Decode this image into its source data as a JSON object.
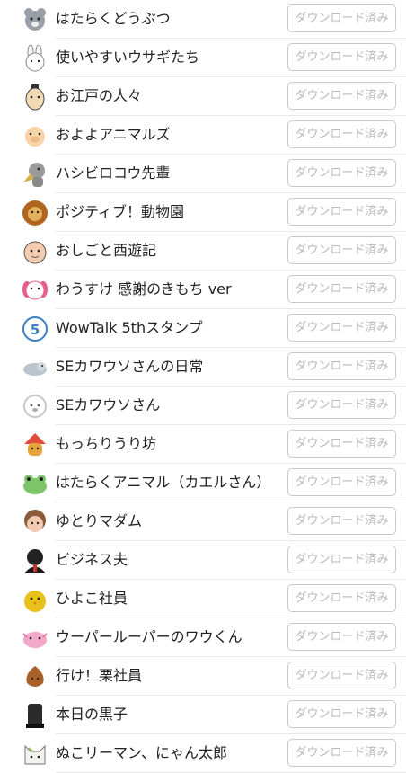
{
  "stickers": [
    {
      "name": "はたらくどうぶつ",
      "button": "ダウンロード済み",
      "icon": "bear-icon",
      "color": "#9aa0a8"
    },
    {
      "name": "使いやすいウサギたち",
      "button": "ダウンロード済み",
      "icon": "rabbit-icon",
      "color": "#f5f5f5"
    },
    {
      "name": "お江戸の人々",
      "button": "ダウンロード済み",
      "icon": "edo-person-icon",
      "color": "#f1d9b5"
    },
    {
      "name": "およよアニマルズ",
      "button": "ダウンロード済み",
      "icon": "pig-icon",
      "color": "#f7d3a8"
    },
    {
      "name": "ハシビロコウ先輩",
      "button": "ダウンロード済み",
      "icon": "shoebill-icon",
      "color": "#9a9a9a"
    },
    {
      "name": "ポジティブ！動物園",
      "button": "ダウンロード済み",
      "icon": "lion-icon",
      "color": "#b0651f"
    },
    {
      "name": "おしごと西遊記",
      "button": "ダウンロード済み",
      "icon": "monk-icon",
      "color": "#f3ccb0"
    },
    {
      "name": "わうすけ 感謝のきもち ver",
      "button": "ダウンロード済み",
      "icon": "dog-icon",
      "color": "#e85d8a"
    },
    {
      "name": "WowTalk 5thスタンプ",
      "button": "ダウンロード済み",
      "icon": "anniversary-5-icon",
      "color": "#3d7fc4"
    },
    {
      "name": "SEカワウソさんの日常",
      "button": "ダウンロード済み",
      "icon": "otter-icon",
      "color": "#b9c4cc"
    },
    {
      "name": "SEカワウソさん",
      "button": "ダウンロード済み",
      "icon": "otter-face-icon",
      "color": "#c9c9c9"
    },
    {
      "name": "もっちりうり坊",
      "button": "ダウンロード済み",
      "icon": "boar-icon",
      "color": "#e6a23c"
    },
    {
      "name": "はたらくアニマル（カエルさん）",
      "button": "ダウンロード済み",
      "icon": "frog-icon",
      "color": "#7cc46a"
    },
    {
      "name": "ゆとりマダム",
      "button": "ダウンロード済み",
      "icon": "madam-icon",
      "color": "#f0c9b0"
    },
    {
      "name": "ビジネス夫",
      "button": "ダウンロード済み",
      "icon": "business-man-icon",
      "color": "#222222"
    },
    {
      "name": "ひよこ社員",
      "button": "ダウンロード済み",
      "icon": "chick-icon",
      "color": "#e8c11a"
    },
    {
      "name": "ウーパールーパーのワウくん",
      "button": "ダウンロード済み",
      "icon": "axolotl-icon",
      "color": "#f2a9c8"
    },
    {
      "name": "行け！栗社員",
      "button": "ダウンロード済み",
      "icon": "chestnut-icon",
      "color": "#a8612a"
    },
    {
      "name": "本日の黒子",
      "button": "ダウンロード済み",
      "icon": "kuroko-icon",
      "color": "#2b2b2b"
    },
    {
      "name": "ぬこリーマン、にゃん太郎",
      "button": "ダウンロード済み",
      "icon": "cat-icon",
      "color": "#f2f2ee"
    }
  ]
}
